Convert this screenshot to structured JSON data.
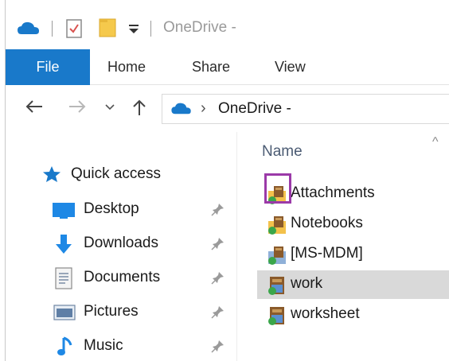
{
  "window": {
    "title": "OneDrive -"
  },
  "ribbon": {
    "tabs": [
      {
        "label": "File",
        "active": true
      },
      {
        "label": "Home"
      },
      {
        "label": "Share"
      },
      {
        "label": "View"
      }
    ]
  },
  "address": {
    "crumb": "OneDrive -",
    "separator": "›"
  },
  "nav": {
    "items": [
      {
        "label": "Quick access",
        "icon": "star-icon",
        "pinned": false
      },
      {
        "label": "Desktop",
        "icon": "desktop-icon",
        "pinned": true
      },
      {
        "label": "Downloads",
        "icon": "download-arrow-icon",
        "pinned": true
      },
      {
        "label": "Documents",
        "icon": "document-icon",
        "pinned": true
      },
      {
        "label": "Pictures",
        "icon": "pictures-icon",
        "pinned": true
      },
      {
        "label": "Music",
        "icon": "music-note-icon",
        "pinned": true
      }
    ]
  },
  "files": {
    "column_header": "Name",
    "items": [
      {
        "name": "Attachments",
        "selected": false
      },
      {
        "name": "Notebooks",
        "selected": false
      },
      {
        "name": "[MS-MDM]",
        "selected": false
      },
      {
        "name": "work",
        "selected": true
      },
      {
        "name": "worksheet",
        "selected": false
      }
    ]
  },
  "colors": {
    "accent": "#1979ca",
    "selection": "#d9d9d9",
    "highlight": "#9b3aa8"
  }
}
